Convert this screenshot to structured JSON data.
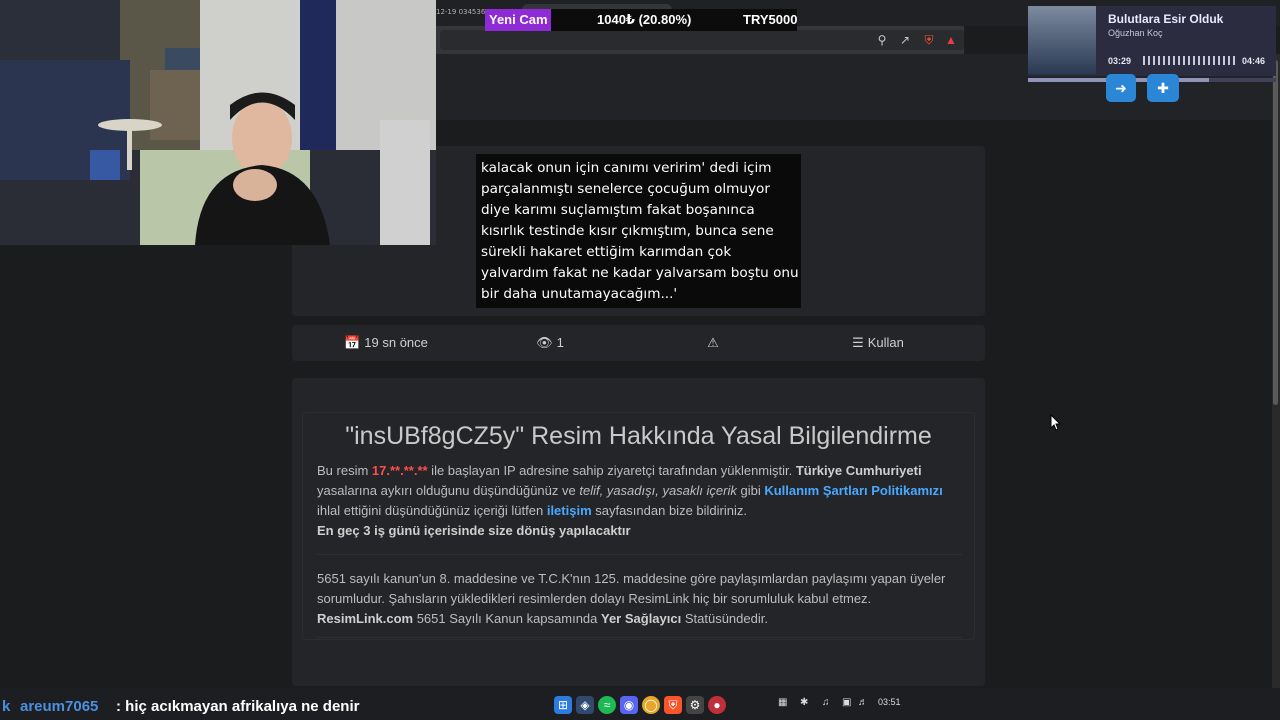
{
  "browser": {
    "tab_time": "12-19 034536",
    "icons": [
      "zoom-icon",
      "share-icon",
      "brave-shield-icon",
      "brave-rewards-icon"
    ]
  },
  "ticker": {
    "name": "Yeni Cam",
    "value": "1040₺ (20.80%)",
    "target": "TRY5000"
  },
  "caption": {
    "text": "kalacak onun için canımı veririm' dedi içim parçalanmıştı senelerce çocuğum olmuyor diye karımı suçlamıştım fakat boşanınca kısırlık testinde kısır çıkmıştım, bunca sene sürekli hakaret ettiğim karımdan çok yalvardım fakat ne kadar yalvarsam boştu onu bir daha unutamayacağım...'"
  },
  "meta": {
    "time": "19 sn önce",
    "views": "1",
    "use_label": "Kullan"
  },
  "legal": {
    "title": "\"insUBf8gCZ5y\" Resim Hakkında Yasal Bilgilendirme",
    "p1_a": "Bu resim ",
    "p1_ip": "17.**.**.**",
    "p1_b": " ile başlayan IP adresine sahip ziyaretçi tarafından yüklenmiştir. ",
    "p1_c": "Türkiye Cumhuriyeti",
    "p1_d": " yasalarına aykırı olduğunu düşündüğünüz ve ",
    "p1_e": "telif, yasadışı, yasaklı içerik",
    "p1_f": " gibi ",
    "p1_link1": "Kullanım Şartları Politikamızı",
    "p1_g": " ihlal ettiğini düşündüğünüz içeriği lütfen ",
    "p1_link2": "iletişim",
    "p1_h": " sayfasından bize bildiriniz.",
    "p1_bold": "En geç 3 iş günü içerisinde size dönüş yapılacaktır",
    "p2_a": "5651 sayılı kanun'un 8. maddesine ve T.C.K'nın 125. maddesine göre paylaşımlardan paylaşımı yapan üyeler sorumludur. Şahısların yükledikleri resimlerden dolayı ResimLink hiç bir sorumluluk kabul etmez.",
    "p2_site": "ResimLink.com",
    "p2_b": " 5651 Sayılı Kanun kapsamında ",
    "p2_role": "Yer Sağlayıcı",
    "p2_c": " Statüsündedir."
  },
  "music": {
    "title": "Bulutlara Esir Olduk",
    "artist": "Oğuzhan Koç",
    "elapsed": "03:29",
    "total": "04:46",
    "progress": 0.73
  },
  "chat": {
    "prefix": "k",
    "user": "areum7065",
    "message": ": hiç acıkmayan afrikalıya ne denir"
  },
  "taskbar": {
    "clock": "03:51"
  }
}
